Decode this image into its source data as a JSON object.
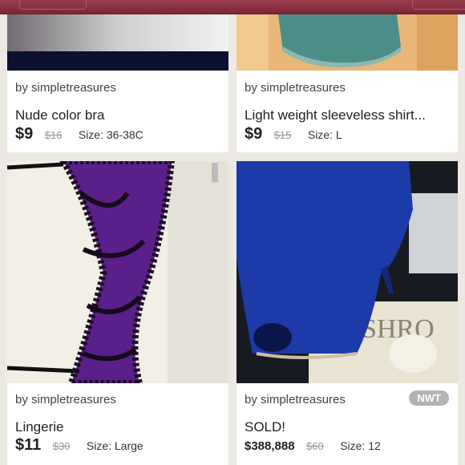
{
  "listings": [
    {
      "seller": "by simpletreasures",
      "title": "Nude color bra",
      "price": "$9",
      "original_price": "$16",
      "size": "Size: 36-38C"
    },
    {
      "seller": "by simpletreasures",
      "title": "Light weight sleeveless shirt...",
      "price": "$9",
      "original_price": "$15",
      "size": "Size: L"
    },
    {
      "seller": "by simpletreasures",
      "title": "Lingerie",
      "price": "$11",
      "original_price": "$30",
      "size": "Size: Large"
    },
    {
      "seller": "by simpletreasures",
      "title": "SOLD!",
      "price": "$388,888",
      "original_price": "$60",
      "size": "Size: 12",
      "badge": "NWT"
    }
  ],
  "magazine_text": "FASHRO"
}
